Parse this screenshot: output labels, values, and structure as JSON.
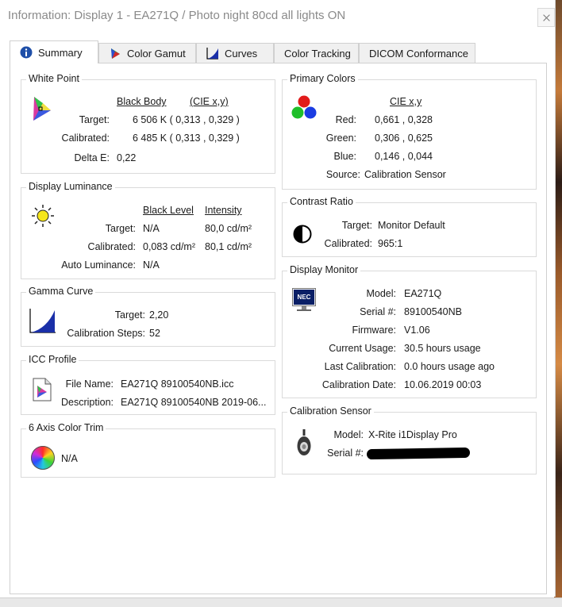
{
  "window": {
    "title": "Information: Display 1 - EA271Q / Photo night  80cd all lights ON"
  },
  "tabs": [
    {
      "label": "Summary",
      "icon": "info-icon",
      "active": true
    },
    {
      "label": "Color Gamut",
      "icon": "color-gamut-icon"
    },
    {
      "label": "Curves",
      "icon": "curves-icon"
    },
    {
      "label": "Color Tracking"
    },
    {
      "label": "DICOM Conformance"
    }
  ],
  "white_point": {
    "title": "White Point",
    "col1": "Black Body",
    "col2": "(CIE x,y)",
    "target_label": "Target:",
    "target_value": "6 506 K  ( 0,313 , 0,329 )",
    "calibrated_label": "Calibrated:",
    "calibrated_value": "6 485 K  ( 0,313 , 0,329 )",
    "delta_label": "Delta E:",
    "delta_value": "0,22"
  },
  "luminance": {
    "title": "Display Luminance",
    "col1": "Black Level",
    "col2": "Intensity",
    "target_label": "Target:",
    "target_black": "N/A",
    "target_int": "80,0 cd/m²",
    "calibrated_label": "Calibrated:",
    "cal_black": "0,083 cd/m²",
    "cal_int": "80,1 cd/m²",
    "auto_label": "Auto Luminance:",
    "auto_value": "N/A"
  },
  "gamma": {
    "title": "Gamma Curve",
    "target_label": "Target:",
    "target_value": "2,20",
    "steps_label": "Calibration Steps:",
    "steps_value": "52"
  },
  "icc": {
    "title": "ICC Profile",
    "file_label": "File Name:",
    "file_value": "EA271Q 89100540NB.icc",
    "desc_label": "Description:",
    "desc_value": "EA271Q 89100540NB 2019-06..."
  },
  "color_trim": {
    "title": "6 Axis Color Trim",
    "value": "N/A"
  },
  "primaries": {
    "title": "Primary Colors",
    "col": "CIE x,y",
    "red_label": "Red:",
    "red_value": "0,661 , 0,328",
    "green_label": "Green:",
    "green_value": "0,306 , 0,625",
    "blue_label": "Blue:",
    "blue_value": "0,146 , 0,044",
    "source_label": "Source:",
    "source_value": "Calibration Sensor"
  },
  "contrast": {
    "title": "Contrast Ratio",
    "target_label": "Target:",
    "target_value": "Monitor Default",
    "cal_label": "Calibrated:",
    "cal_value": "965:1"
  },
  "monitor": {
    "title": "Display Monitor",
    "logo": "NEC",
    "model_label": "Model:",
    "model_value": "EA271Q",
    "serial_label": "Serial #:",
    "serial_value": "89100540NB",
    "firmware_label": "Firmware:",
    "firmware_value": "V1.06",
    "usage_label": "Current Usage:",
    "usage_value": "30.5 hours usage",
    "lastcal_label": "Last Calibration:",
    "lastcal_value": "0.0 hours usage ago",
    "caldate_label": "Calibration Date:",
    "caldate_value": "10.06.2019 00:03"
  },
  "sensor": {
    "title": "Calibration Sensor",
    "model_label": "Model:",
    "model_value": "X-Rite i1Display Pro",
    "serial_label": "Serial #:"
  }
}
